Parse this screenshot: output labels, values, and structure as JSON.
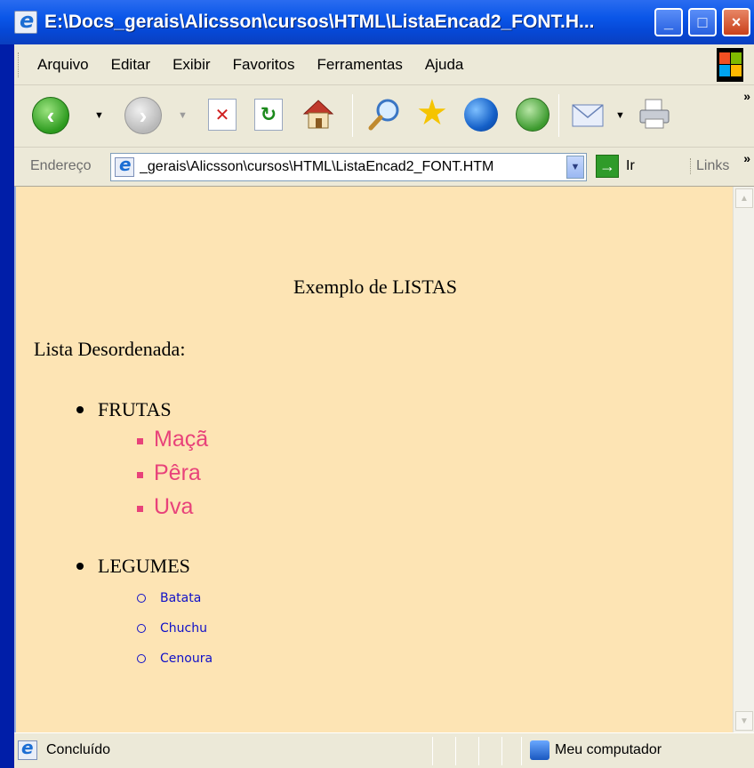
{
  "window": {
    "title": "E:\\Docs_gerais\\Alicsson\\cursos\\HTML\\ListaEncad2_FONT.H...",
    "minimize": "_",
    "maximize": "□",
    "close": "×"
  },
  "menu": [
    "Arquivo",
    "Editar",
    "Exibir",
    "Favoritos",
    "Ferramentas",
    "Ajuda"
  ],
  "toolbar": {
    "icons": [
      "back-icon",
      "forward-icon",
      "stop-icon",
      "refresh-icon",
      "home-icon",
      "search-icon",
      "favorites-icon",
      "media-icon",
      "history-icon",
      "mail-icon",
      "print-icon"
    ],
    "overflow": "»"
  },
  "address": {
    "label": "Endereço",
    "value": "_gerais\\Alicsson\\cursos\\HTML\\ListaEncad2_FONT.HTM",
    "go_label": "Ir",
    "links_label": "Links",
    "links_overflow": "»"
  },
  "page": {
    "background": "#fde4b4",
    "title": "Exemplo de LISTAS",
    "list_caption": "Lista Desordenada:",
    "categories": [
      {
        "label": "FRUTAS",
        "color": "#e8427a",
        "items": [
          "Maçã",
          "Pêra",
          "Uva"
        ]
      },
      {
        "label": "LEGUMES",
        "color": "#1010c8",
        "items": [
          "Batata",
          "Chuchu",
          "Cenoura"
        ]
      }
    ]
  },
  "status": {
    "text": "Concluído",
    "zone": "Meu computador"
  }
}
